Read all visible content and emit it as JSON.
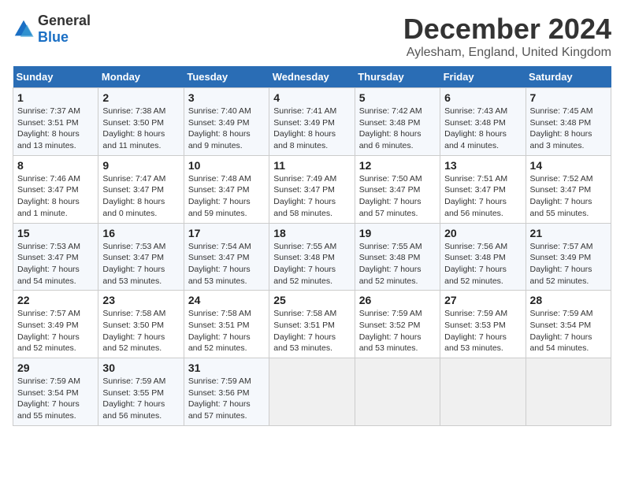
{
  "logo": {
    "text_general": "General",
    "text_blue": "Blue"
  },
  "title": "December 2024",
  "subtitle": "Aylesham, England, United Kingdom",
  "days_header": [
    "Sunday",
    "Monday",
    "Tuesday",
    "Wednesday",
    "Thursday",
    "Friday",
    "Saturday"
  ],
  "weeks": [
    [
      {
        "day": "1",
        "sunrise": "Sunrise: 7:37 AM",
        "sunset": "Sunset: 3:51 PM",
        "daylight": "Daylight: 8 hours and 13 minutes."
      },
      {
        "day": "2",
        "sunrise": "Sunrise: 7:38 AM",
        "sunset": "Sunset: 3:50 PM",
        "daylight": "Daylight: 8 hours and 11 minutes."
      },
      {
        "day": "3",
        "sunrise": "Sunrise: 7:40 AM",
        "sunset": "Sunset: 3:49 PM",
        "daylight": "Daylight: 8 hours and 9 minutes."
      },
      {
        "day": "4",
        "sunrise": "Sunrise: 7:41 AM",
        "sunset": "Sunset: 3:49 PM",
        "daylight": "Daylight: 8 hours and 8 minutes."
      },
      {
        "day": "5",
        "sunrise": "Sunrise: 7:42 AM",
        "sunset": "Sunset: 3:48 PM",
        "daylight": "Daylight: 8 hours and 6 minutes."
      },
      {
        "day": "6",
        "sunrise": "Sunrise: 7:43 AM",
        "sunset": "Sunset: 3:48 PM",
        "daylight": "Daylight: 8 hours and 4 minutes."
      },
      {
        "day": "7",
        "sunrise": "Sunrise: 7:45 AM",
        "sunset": "Sunset: 3:48 PM",
        "daylight": "Daylight: 8 hours and 3 minutes."
      }
    ],
    [
      {
        "day": "8",
        "sunrise": "Sunrise: 7:46 AM",
        "sunset": "Sunset: 3:47 PM",
        "daylight": "Daylight: 8 hours and 1 minute."
      },
      {
        "day": "9",
        "sunrise": "Sunrise: 7:47 AM",
        "sunset": "Sunset: 3:47 PM",
        "daylight": "Daylight: 8 hours and 0 minutes."
      },
      {
        "day": "10",
        "sunrise": "Sunrise: 7:48 AM",
        "sunset": "Sunset: 3:47 PM",
        "daylight": "Daylight: 7 hours and 59 minutes."
      },
      {
        "day": "11",
        "sunrise": "Sunrise: 7:49 AM",
        "sunset": "Sunset: 3:47 PM",
        "daylight": "Daylight: 7 hours and 58 minutes."
      },
      {
        "day": "12",
        "sunrise": "Sunrise: 7:50 AM",
        "sunset": "Sunset: 3:47 PM",
        "daylight": "Daylight: 7 hours and 57 minutes."
      },
      {
        "day": "13",
        "sunrise": "Sunrise: 7:51 AM",
        "sunset": "Sunset: 3:47 PM",
        "daylight": "Daylight: 7 hours and 56 minutes."
      },
      {
        "day": "14",
        "sunrise": "Sunrise: 7:52 AM",
        "sunset": "Sunset: 3:47 PM",
        "daylight": "Daylight: 7 hours and 55 minutes."
      }
    ],
    [
      {
        "day": "15",
        "sunrise": "Sunrise: 7:53 AM",
        "sunset": "Sunset: 3:47 PM",
        "daylight": "Daylight: 7 hours and 54 minutes."
      },
      {
        "day": "16",
        "sunrise": "Sunrise: 7:53 AM",
        "sunset": "Sunset: 3:47 PM",
        "daylight": "Daylight: 7 hours and 53 minutes."
      },
      {
        "day": "17",
        "sunrise": "Sunrise: 7:54 AM",
        "sunset": "Sunset: 3:47 PM",
        "daylight": "Daylight: 7 hours and 53 minutes."
      },
      {
        "day": "18",
        "sunrise": "Sunrise: 7:55 AM",
        "sunset": "Sunset: 3:48 PM",
        "daylight": "Daylight: 7 hours and 52 minutes."
      },
      {
        "day": "19",
        "sunrise": "Sunrise: 7:55 AM",
        "sunset": "Sunset: 3:48 PM",
        "daylight": "Daylight: 7 hours and 52 minutes."
      },
      {
        "day": "20",
        "sunrise": "Sunrise: 7:56 AM",
        "sunset": "Sunset: 3:48 PM",
        "daylight": "Daylight: 7 hours and 52 minutes."
      },
      {
        "day": "21",
        "sunrise": "Sunrise: 7:57 AM",
        "sunset": "Sunset: 3:49 PM",
        "daylight": "Daylight: 7 hours and 52 minutes."
      }
    ],
    [
      {
        "day": "22",
        "sunrise": "Sunrise: 7:57 AM",
        "sunset": "Sunset: 3:49 PM",
        "daylight": "Daylight: 7 hours and 52 minutes."
      },
      {
        "day": "23",
        "sunrise": "Sunrise: 7:58 AM",
        "sunset": "Sunset: 3:50 PM",
        "daylight": "Daylight: 7 hours and 52 minutes."
      },
      {
        "day": "24",
        "sunrise": "Sunrise: 7:58 AM",
        "sunset": "Sunset: 3:51 PM",
        "daylight": "Daylight: 7 hours and 52 minutes."
      },
      {
        "day": "25",
        "sunrise": "Sunrise: 7:58 AM",
        "sunset": "Sunset: 3:51 PM",
        "daylight": "Daylight: 7 hours and 53 minutes."
      },
      {
        "day": "26",
        "sunrise": "Sunrise: 7:59 AM",
        "sunset": "Sunset: 3:52 PM",
        "daylight": "Daylight: 7 hours and 53 minutes."
      },
      {
        "day": "27",
        "sunrise": "Sunrise: 7:59 AM",
        "sunset": "Sunset: 3:53 PM",
        "daylight": "Daylight: 7 hours and 53 minutes."
      },
      {
        "day": "28",
        "sunrise": "Sunrise: 7:59 AM",
        "sunset": "Sunset: 3:54 PM",
        "daylight": "Daylight: 7 hours and 54 minutes."
      }
    ],
    [
      {
        "day": "29",
        "sunrise": "Sunrise: 7:59 AM",
        "sunset": "Sunset: 3:54 PM",
        "daylight": "Daylight: 7 hours and 55 minutes."
      },
      {
        "day": "30",
        "sunrise": "Sunrise: 7:59 AM",
        "sunset": "Sunset: 3:55 PM",
        "daylight": "Daylight: 7 hours and 56 minutes."
      },
      {
        "day": "31",
        "sunrise": "Sunrise: 7:59 AM",
        "sunset": "Sunset: 3:56 PM",
        "daylight": "Daylight: 7 hours and 57 minutes."
      },
      null,
      null,
      null,
      null
    ]
  ]
}
